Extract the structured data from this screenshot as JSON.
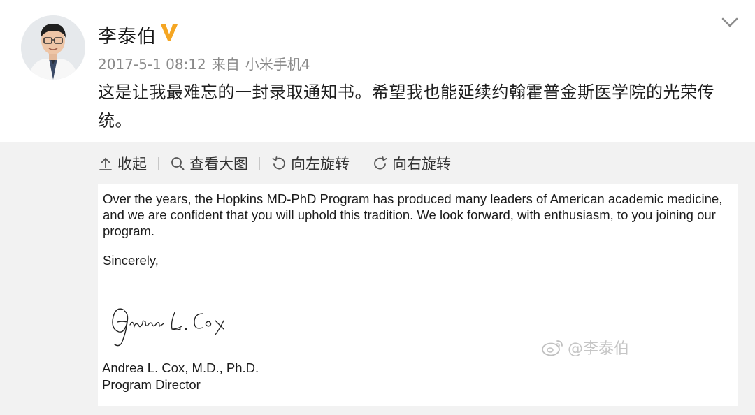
{
  "post": {
    "user": {
      "name": "李泰伯",
      "verified_badge": "V",
      "avatar_icon": "profile-photo"
    },
    "meta": {
      "timestamp": "2017-5-1 08:12",
      "source_prefix": "来自",
      "device": "小米手机4"
    },
    "text": "这是让我最难忘的一封录取通知书。希望我也能延续约翰霍普金斯医学院的光荣传统。",
    "colors": {
      "badge": "#F5A623",
      "meta_text": "#8a8a8a",
      "media_bg": "#f2f2f2"
    }
  },
  "toolbar": {
    "collapse": "收起",
    "view_large": "查看大图",
    "rotate_left": "向左旋转",
    "rotate_right": "向右旋转"
  },
  "letter": {
    "body": "Over the years, the Hopkins MD-PhD Program has produced many leaders of American academic medicine, and we are confident that you will uphold this tradition.  We look forward, with enthusiasm, to you joining our program.",
    "closing": "Sincerely,",
    "signature_text": "Andrea L. Cox",
    "signer_name": "Andrea L. Cox, M.D., Ph.D.",
    "signer_title": "Program Director"
  },
  "watermark": {
    "text": "@李泰伯",
    "icon": "weibo-logo-icon"
  }
}
